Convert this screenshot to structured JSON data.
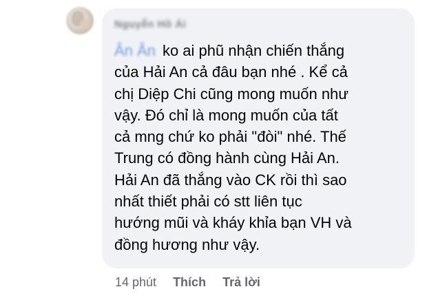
{
  "comment": {
    "author_name": "Nguyễn Hồ Ái",
    "mention": "Ân Ân",
    "text_lines": [
      "ko ai phũ nhận chiến thắng",
      "của Hải An cả đâu bạn nhé . Kể cả",
      "chị Diệp Chi cũng mong muốn như",
      "vậy. Đó chỉ là mong muốn của tất",
      "cả mng chứ ko phải \"đòi\" nhé. Thế",
      "Trung có đồng hành cùng Hải An.",
      "Hải An đã thắng vào CK rồi thì sao",
      "nhất thiết phải có stt liên tục",
      "hướng mũi và kháy khỉa bạn VH và",
      "đồng hương như vậy."
    ]
  },
  "actions": {
    "time": "14 phút",
    "like_label": "Thích",
    "reply_label": "Trả lời"
  }
}
